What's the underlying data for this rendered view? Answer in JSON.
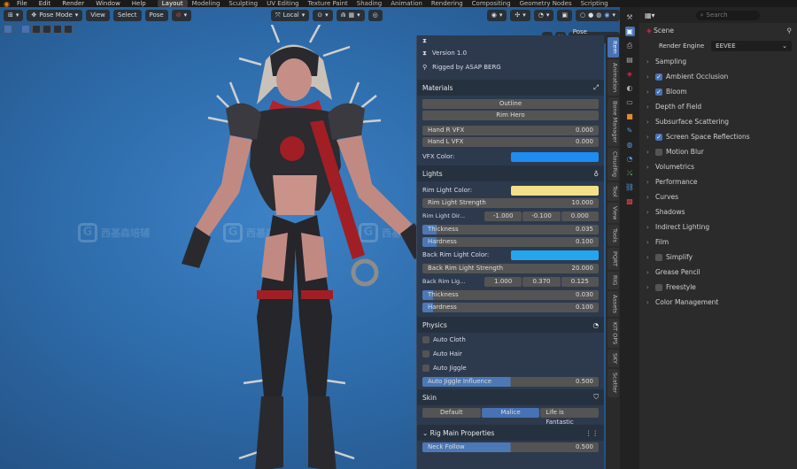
{
  "menu": {
    "items": [
      "File",
      "Edit",
      "Render",
      "Window",
      "Help"
    ],
    "workspaces": [
      "Layout",
      "Modeling",
      "Sculpting",
      "UV Editing",
      "Texture Paint",
      "Shading",
      "Animation",
      "Rendering",
      "Compositing",
      "Geometry Nodes",
      "Scripting"
    ]
  },
  "viewport": {
    "mode": "Pose Mode",
    "view": "View",
    "select": "Select",
    "pose": "Pose",
    "orientation": "Local",
    "pose_options": "Pose Options"
  },
  "panel": {
    "version": "Version 1.0",
    "rigged_by": "Rigged by ASAP BERG",
    "materials": "Materials",
    "outline": "Outline",
    "rim_hero": "Rim Hero",
    "hand_r": {
      "label": "Hand R VFX",
      "value": "0.000"
    },
    "hand_l": {
      "label": "Hand L VFX",
      "value": "0.000"
    },
    "vfx_color": "VFX Color:",
    "lights": "Lights",
    "rim_light_color": "Rim Light Color:",
    "rim_light_strength": {
      "label": "Rim Light Strength",
      "value": "10.000"
    },
    "rim_light_dir": {
      "label": "Rim Light Dir...",
      "x": "-1.000",
      "y": "-0.100",
      "z": "0.000"
    },
    "thickness1": {
      "label": "Thickness",
      "value": "0.035"
    },
    "hardness1": {
      "label": "Hardness",
      "value": "0.100"
    },
    "back_rim_color": "Back Rim Light Color:",
    "back_rim_strength": {
      "label": "Back Rim Light Strength",
      "value": "20.000"
    },
    "back_rim_dir": {
      "label": "Back Rim Lig...",
      "x": "1.000",
      "y": "0.370",
      "z": "0.125"
    },
    "thickness2": {
      "label": "Thickness",
      "value": "0.030"
    },
    "hardness2": {
      "label": "Hardness",
      "value": "0.100"
    },
    "physics": "Physics",
    "auto_cloth": "Auto Cloth",
    "auto_hair": "Auto Hair",
    "auto_jiggle": "Auto Jiggle",
    "jiggle_influence": {
      "label": "Auto Jiggle Influence",
      "value": "0.500",
      "fraction": 0.5
    },
    "skin": "Skin",
    "skin_options": [
      "Default",
      "Malice",
      "Life is Fantastic"
    ],
    "rig_main": "Rig Main Properties",
    "neck_follow": {
      "label": "Neck Follow",
      "value": "0.500",
      "fraction": 0.5
    }
  },
  "tabs": [
    "Item",
    "Animation",
    "Bone Manager",
    "CloudRig",
    "Tool",
    "View",
    "Tools",
    "PQRT",
    "RIG",
    "Assets",
    "KIT OPS",
    "SKY",
    "Scatter"
  ],
  "colors": {
    "vfx": "#1e8cf0",
    "rim": "#f3e08a",
    "back_rim": "#23a6ef",
    "accent": "#4772b3",
    "panel": "#2d3a4d"
  },
  "watermark": "西基森培辅",
  "properties": {
    "search_placeholder": "Search",
    "scene": "Scene",
    "render_engine_label": "Render Engine",
    "render_engine": "EEVEE",
    "sections": [
      {
        "label": "Sampling",
        "check": null
      },
      {
        "label": "Ambient Occlusion",
        "check": true
      },
      {
        "label": "Bloom",
        "check": true
      },
      {
        "label": "Depth of Field",
        "check": null
      },
      {
        "label": "Subsurface Scattering",
        "check": null
      },
      {
        "label": "Screen Space Reflections",
        "check": true
      },
      {
        "label": "Motion Blur",
        "check": false
      },
      {
        "label": "Volumetrics",
        "check": null
      },
      {
        "label": "Performance",
        "check": null
      },
      {
        "label": "Curves",
        "check": null
      },
      {
        "label": "Shadows",
        "check": null
      },
      {
        "label": "Indirect Lighting",
        "check": null
      },
      {
        "label": "Film",
        "check": null
      },
      {
        "label": "Simplify",
        "check": false
      },
      {
        "label": "Grease Pencil",
        "check": null
      },
      {
        "label": "Freestyle",
        "check": false
      },
      {
        "label": "Color Management",
        "check": null
      }
    ]
  }
}
